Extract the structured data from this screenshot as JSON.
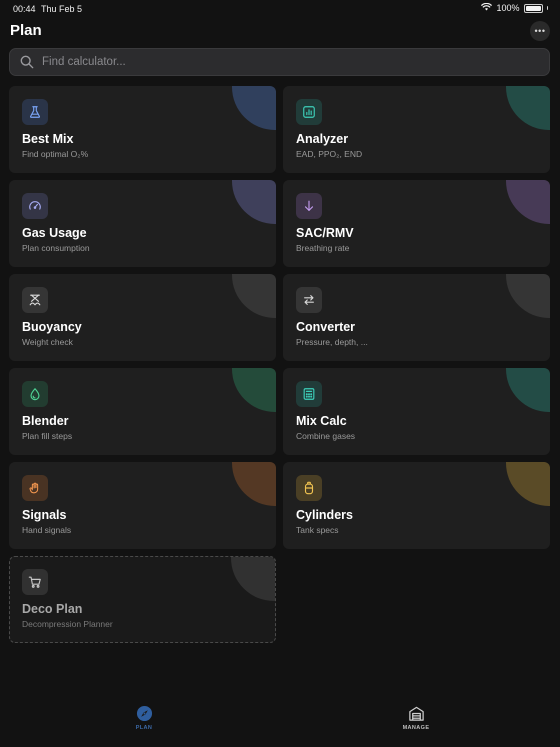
{
  "status_bar": {
    "time": "00:44",
    "date": "Thu Feb 5",
    "battery": "100%"
  },
  "header": {
    "title": "Plan",
    "more_icon": "ellipsis-icon"
  },
  "search": {
    "placeholder": "Find calculator...",
    "value": ""
  },
  "cards": [
    {
      "title": "Best Mix",
      "subtitle": "Find optimal O₂%",
      "icon": "flask-icon",
      "accent": "#5b8def"
    },
    {
      "title": "Analyzer",
      "subtitle": "EAD, PPO₂, END",
      "icon": "chart-icon",
      "accent": "#2fb5a3"
    },
    {
      "title": "Gas Usage",
      "subtitle": "Plan consumption",
      "icon": "gauge-icon",
      "accent": "#8a90e8"
    },
    {
      "title": "SAC/RMV",
      "subtitle": "Breathing rate",
      "icon": "arrow-down-icon",
      "accent": "#a77bd6"
    },
    {
      "title": "Buoyancy",
      "subtitle": "Weight check",
      "icon": "balance-icon",
      "accent": "#bdbdbd"
    },
    {
      "title": "Converter",
      "subtitle": "Pressure, depth, ...",
      "icon": "swap-icon",
      "accent": "#bdbdbd"
    },
    {
      "title": "Blender",
      "subtitle": "Plan fill steps",
      "icon": "drop-icon",
      "accent": "#33b37a"
    },
    {
      "title": "Mix Calc",
      "subtitle": "Combine gases",
      "icon": "calculator-icon",
      "accent": "#2fb5a3"
    },
    {
      "title": "Signals",
      "subtitle": "Hand signals",
      "icon": "hand-icon",
      "accent": "#e07b34"
    },
    {
      "title": "Cylinders",
      "subtitle": "Tank specs",
      "icon": "cylinder-icon",
      "accent": "#e3b23c"
    },
    {
      "title": "Deco Plan",
      "subtitle": "Decompression Planner",
      "icon": "cart-icon",
      "accent": "#9a9a9a"
    }
  ],
  "tabbar": {
    "tabs": [
      {
        "label": "PLAN",
        "icon": "compass-icon",
        "active": true
      },
      {
        "label": "MANAGE",
        "icon": "warehouse-icon",
        "active": false
      }
    ]
  }
}
